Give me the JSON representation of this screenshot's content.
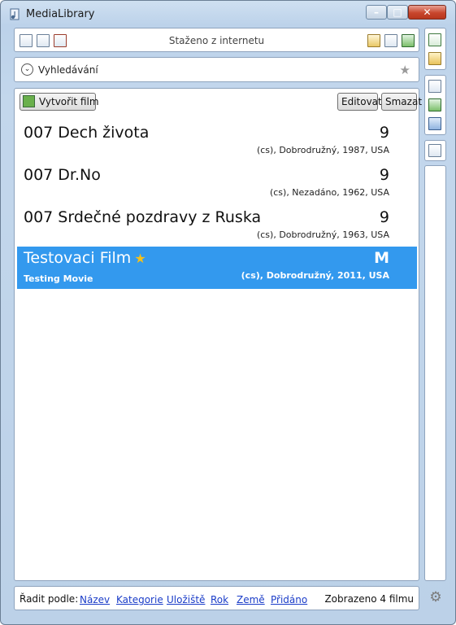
{
  "window": {
    "title": "MediaLibrary"
  },
  "toolbar": {
    "title": "Staženo z internetu"
  },
  "search": {
    "label": "Vyhledávání"
  },
  "actions": {
    "create_label": "Vytvořit film",
    "edit_label": "Editovat",
    "delete_label": "Smazat"
  },
  "films": [
    {
      "name": "007 Dech života",
      "rating": "9",
      "meta": "(cs), Dobrodružný, 1987, USA",
      "subtitle": "",
      "favorite": false,
      "selected": false
    },
    {
      "name": "007 Dr.No",
      "rating": "9",
      "meta": "(cs), Nezadáno, 1962, USA",
      "subtitle": "",
      "favorite": false,
      "selected": false
    },
    {
      "name": "007 Srdečné pozdravy z Ruska",
      "rating": "9",
      "meta": "(cs), Dobrodružný, 1963, USA",
      "subtitle": "",
      "favorite": false,
      "selected": false
    },
    {
      "name": "Testovaci Film",
      "rating": "M",
      "meta": "(cs), Dobrodružný, 2011, USA",
      "subtitle": "Testing Movie",
      "favorite": true,
      "selected": true
    }
  ],
  "sort": {
    "label": "Řadit podle:",
    "options": [
      "Název",
      "Kategorie",
      "Uložiště",
      "Rok",
      "Země",
      "Přidáno"
    ]
  },
  "status": {
    "count_text": "Zobrazeno 4 filmu"
  },
  "colors": {
    "selection": "#3399ee",
    "link": "#1a3cc8",
    "star": "#f4c01a"
  }
}
